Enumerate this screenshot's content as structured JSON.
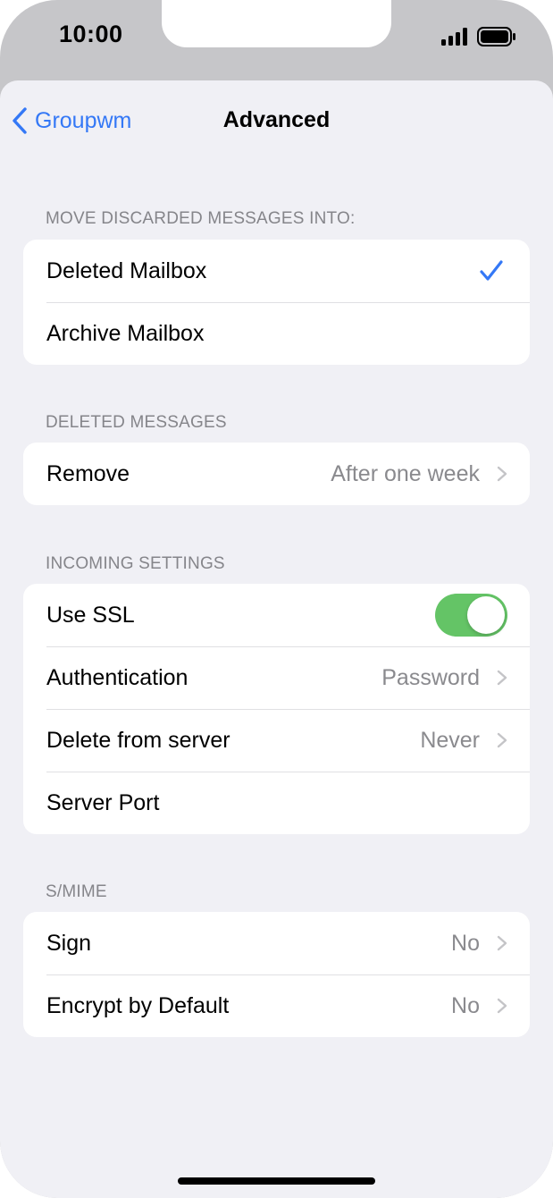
{
  "status_bar": {
    "time": "10:00"
  },
  "nav": {
    "back_label": "Groupwm",
    "title": "Advanced"
  },
  "sections": {
    "discarded": {
      "header": "MOVE DISCARDED MESSAGES INTO:",
      "rows": [
        {
          "label": "Deleted Mailbox",
          "selected": true
        },
        {
          "label": "Archive Mailbox",
          "selected": false
        }
      ]
    },
    "deleted": {
      "header": "DELETED MESSAGES",
      "rows": [
        {
          "label": "Remove",
          "value": "After one week"
        }
      ]
    },
    "incoming": {
      "header": "INCOMING SETTINGS",
      "rows": [
        {
          "label": "Use SSL",
          "toggle_on": true
        },
        {
          "label": "Authentication",
          "value": "Password"
        },
        {
          "label": "Delete from server",
          "value": "Never"
        },
        {
          "label": "Server Port"
        }
      ]
    },
    "smime": {
      "header": "S/MIME",
      "rows": [
        {
          "label": "Sign",
          "value": "No"
        },
        {
          "label": "Encrypt by Default",
          "value": "No"
        }
      ]
    }
  },
  "colors": {
    "accent": "#3478f6",
    "toggle_on": "#64c466",
    "background": "#f0f0f5",
    "secondary_text": "#8a8a8e"
  },
  "icons": {
    "back": "chevron-left-icon",
    "disclosure": "chevron-right-icon",
    "selected": "checkmark-icon",
    "signal": "cellular-signal-icon",
    "battery": "battery-icon"
  }
}
